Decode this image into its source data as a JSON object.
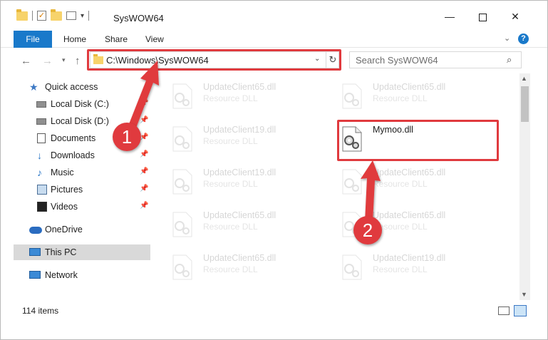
{
  "window": {
    "title": "SysWOW64"
  },
  "title_bar": {
    "qat_dropdown": "▾",
    "minimize": "—",
    "close": "✕"
  },
  "ribbon": {
    "tabs": [
      {
        "label": "File"
      },
      {
        "label": "Home"
      },
      {
        "label": "Share"
      },
      {
        "label": "View"
      }
    ],
    "help": "?"
  },
  "address_bar": {
    "path": "C:\\Windows\\SysWOW64",
    "search_placeholder": "Search SysWOW64"
  },
  "nav_pane": {
    "items": [
      {
        "label": "Quick access",
        "icon": "star-icon"
      },
      {
        "label": "Local Disk (C:)",
        "icon": "drive-icon",
        "pinned": true
      },
      {
        "label": "Local Disk (D:)",
        "icon": "drive-icon",
        "pinned": true
      },
      {
        "label": "Documents",
        "icon": "documents-icon",
        "pinned": true
      },
      {
        "label": "Downloads",
        "icon": "download-icon",
        "pinned": true
      },
      {
        "label": "Music",
        "icon": "music-icon",
        "pinned": true
      },
      {
        "label": "Pictures",
        "icon": "pictures-icon",
        "pinned": true
      },
      {
        "label": "Videos",
        "icon": "videos-icon",
        "pinned": true
      },
      {
        "label": "OneDrive",
        "icon": "cloud-icon"
      },
      {
        "label": "This PC",
        "icon": "computer-icon",
        "selected": true
      },
      {
        "label": "Network",
        "icon": "network-icon"
      }
    ]
  },
  "files": [
    {
      "name": "UpdateClient65.dll",
      "type": "Resource DLL"
    },
    {
      "name": "UpdateClient65.dll",
      "type": "Resource DLL"
    },
    {
      "name": "UpdateClient19.dll",
      "type": "Resource DLL"
    },
    {
      "name": "Mymoo.dll",
      "type": ""
    },
    {
      "name": "UpdateClient19.dll",
      "type": "Resource DLL"
    },
    {
      "name": "UpdateClient65.dll",
      "type": "Resource DLL"
    },
    {
      "name": "UpdateClient65.dll",
      "type": "Resource DLL"
    },
    {
      "name": "UpdateClient65.dll",
      "type": "Resource DLL"
    },
    {
      "name": "UpdateClient65.dll",
      "type": "Resource DLL"
    },
    {
      "name": "UpdateClient19.dll",
      "type": "Resource DLL"
    }
  ],
  "status_bar": {
    "item_count": "114 items"
  },
  "annotations": {
    "step1": "1",
    "step2": "2",
    "highlight_color": "#e03a3e"
  },
  "colors": {
    "accent": "#1979ca",
    "selected_bg": "#d9d9d9"
  }
}
